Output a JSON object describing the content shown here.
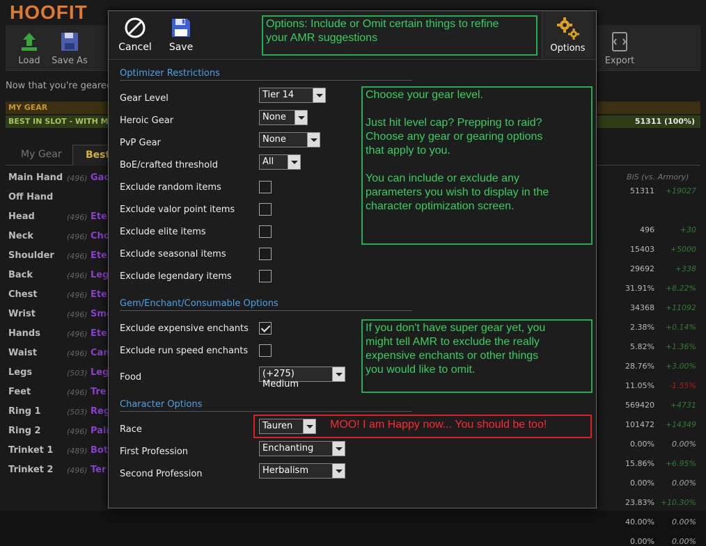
{
  "background": {
    "app_title": "HOOFIT",
    "toolbar": [
      {
        "label": "Load",
        "icon": "upload-icon"
      },
      {
        "label": "Save As",
        "icon": "save-as-icon"
      },
      {
        "label": "Export",
        "icon": "export-icon"
      }
    ],
    "hint": "Now that you're geared",
    "bar_my_gear": "MY GEAR",
    "bar_bis": "BEST IN SLOT - WITH M",
    "bar_bis_value": "51311 (100%)",
    "tabs": [
      "My Gear",
      "Best"
    ],
    "right_header": "BiS (vs. Armory)",
    "slots": [
      {
        "slot": "Main Hand",
        "ilvl": "(496)",
        "name": "Gao",
        "value": "51311",
        "delta": "+19027",
        "delta_color": "#2e7d32"
      },
      {
        "slot": "Off Hand",
        "ilvl": "",
        "name": "",
        "value": "",
        "delta": "",
        "delta_color": "#2e7d32"
      },
      {
        "slot": "Head",
        "ilvl": "(496)",
        "name": "Ete",
        "value": "496",
        "delta": "+30",
        "delta_color": "#2e7d32"
      },
      {
        "slot": "Neck",
        "ilvl": "(496)",
        "name": "Cho",
        "value": "15403",
        "delta": "+5000",
        "delta_color": "#2e7d32"
      },
      {
        "slot": "Shoulder",
        "ilvl": "(496)",
        "name": "Ete",
        "value": "29692",
        "delta": "+338",
        "delta_color": "#2e7d32"
      },
      {
        "slot": "Back",
        "ilvl": "(496)",
        "name": "Leg",
        "value": "31.91%",
        "delta": "+8.22%",
        "delta_color": "#2e7d32"
      },
      {
        "slot": "Chest",
        "ilvl": "(496)",
        "name": "Ete",
        "value": "34368",
        "delta": "+11092",
        "delta_color": "#2e7d32"
      },
      {
        "slot": "Wrist",
        "ilvl": "(496)",
        "name": "Smo",
        "value": "2.38%",
        "delta": "+0.14%",
        "delta_color": "#2e7d32"
      },
      {
        "slot": "Hands",
        "ilvl": "(496)",
        "name": "Ete",
        "value": "5.82%",
        "delta": "+1.36%",
        "delta_color": "#2e7d32"
      },
      {
        "slot": "Waist",
        "ilvl": "(496)",
        "name": "Can",
        "value": "28.76%",
        "delta": "+3.00%",
        "delta_color": "#2e7d32"
      },
      {
        "slot": "Legs",
        "ilvl": "(503)",
        "name": "Leg",
        "value": "11.05%",
        "delta": "-1.55%",
        "delta_color": "#b71c1c"
      },
      {
        "slot": "Feet",
        "ilvl": "(496)",
        "name": "Tre",
        "value": "569420",
        "delta": "+4731",
        "delta_color": "#2e7d32"
      },
      {
        "slot": "Ring 1",
        "ilvl": "(503)",
        "name": "Reg",
        "value": "101472",
        "delta": "+14349",
        "delta_color": "#2e7d32"
      },
      {
        "slot": "Ring 2",
        "ilvl": "(496)",
        "name": "Pair",
        "value": "0.00%",
        "delta": "0.00%",
        "delta_color": "#aaa"
      },
      {
        "slot": "Trinket 1",
        "ilvl": "(489)",
        "name": "Bot",
        "value": "15.86%",
        "delta": "+6.95%",
        "delta_color": "#2e7d32"
      },
      {
        "slot": "Trinket 2",
        "ilvl": "(496)",
        "name": "Ter",
        "value": "0.00%",
        "delta": "0.00%",
        "delta_color": "#aaa"
      },
      {
        "slot": "",
        "ilvl": "",
        "name": "",
        "value": "23.83%",
        "delta": "+10.30%",
        "delta_color": "#2e7d32"
      },
      {
        "slot": "",
        "ilvl": "",
        "name": "",
        "value": "40.00%",
        "delta": "0.00%",
        "delta_color": "#aaa"
      },
      {
        "slot": "",
        "ilvl": "",
        "name": "",
        "value": "0.00%",
        "delta": "0.00%",
        "delta_color": "#aaa"
      }
    ]
  },
  "dialog": {
    "cancel_label": "Cancel",
    "save_label": "Save",
    "options_label": "Options",
    "top_note": "Options: Include or Omit certain things to refine\nyour AMR suggestions",
    "sections": {
      "optimizer": "Optimizer Restrictions",
      "gem": "Gem/Enchant/Consumable Options",
      "character": "Character Options"
    },
    "fields": {
      "gear_level": {
        "label": "Gear Level",
        "value": "Tier 14"
      },
      "heroic_gear": {
        "label": "Heroic Gear",
        "value": "None"
      },
      "pvp_gear": {
        "label": "PvP Gear",
        "value": "None"
      },
      "boe_threshold": {
        "label": "BoE/crafted threshold",
        "value": "All"
      },
      "exclude_random": {
        "label": "Exclude random items",
        "checked": false
      },
      "exclude_valor": {
        "label": "Exclude valor point items",
        "checked": false
      },
      "exclude_elite": {
        "label": "Exclude elite items",
        "checked": false
      },
      "exclude_seasonal": {
        "label": "Exclude seasonal items",
        "checked": false
      },
      "exclude_legendary": {
        "label": "Exclude legendary items",
        "checked": false
      },
      "exclude_expensive": {
        "label": "Exclude expensive enchants",
        "checked": true
      },
      "exclude_run_speed": {
        "label": "Exclude run speed enchants",
        "checked": false
      },
      "food": {
        "label": "Food",
        "value": "(+275) Medium"
      },
      "race": {
        "label": "Race",
        "value": "Tauren"
      },
      "first_profession": {
        "label": "First Profession",
        "value": "Enchanting"
      },
      "second_profession": {
        "label": "Second Profession",
        "value": "Herbalism"
      }
    },
    "notes": {
      "gear": "Choose your gear level.\n\nJust hit level cap? Prepping to raid?\nChoose any gear or gearing options\nthat apply to you.\n\nYou can include or exclude any\nparameters you wish to display in the\ncharacter optimization screen.",
      "enchants": "If you don't have super gear yet, you\nmight tell AMR to exclude the really\nexpensive enchants or other things\nyou would like to omit.",
      "race": "MOO! I am Happy now... You should be too!"
    }
  },
  "colors": {
    "note_green": "#35d15c",
    "note_red": "#ff2a2a",
    "section_blue": "#4aa3e8",
    "brand_orange": "#e07a2c"
  }
}
